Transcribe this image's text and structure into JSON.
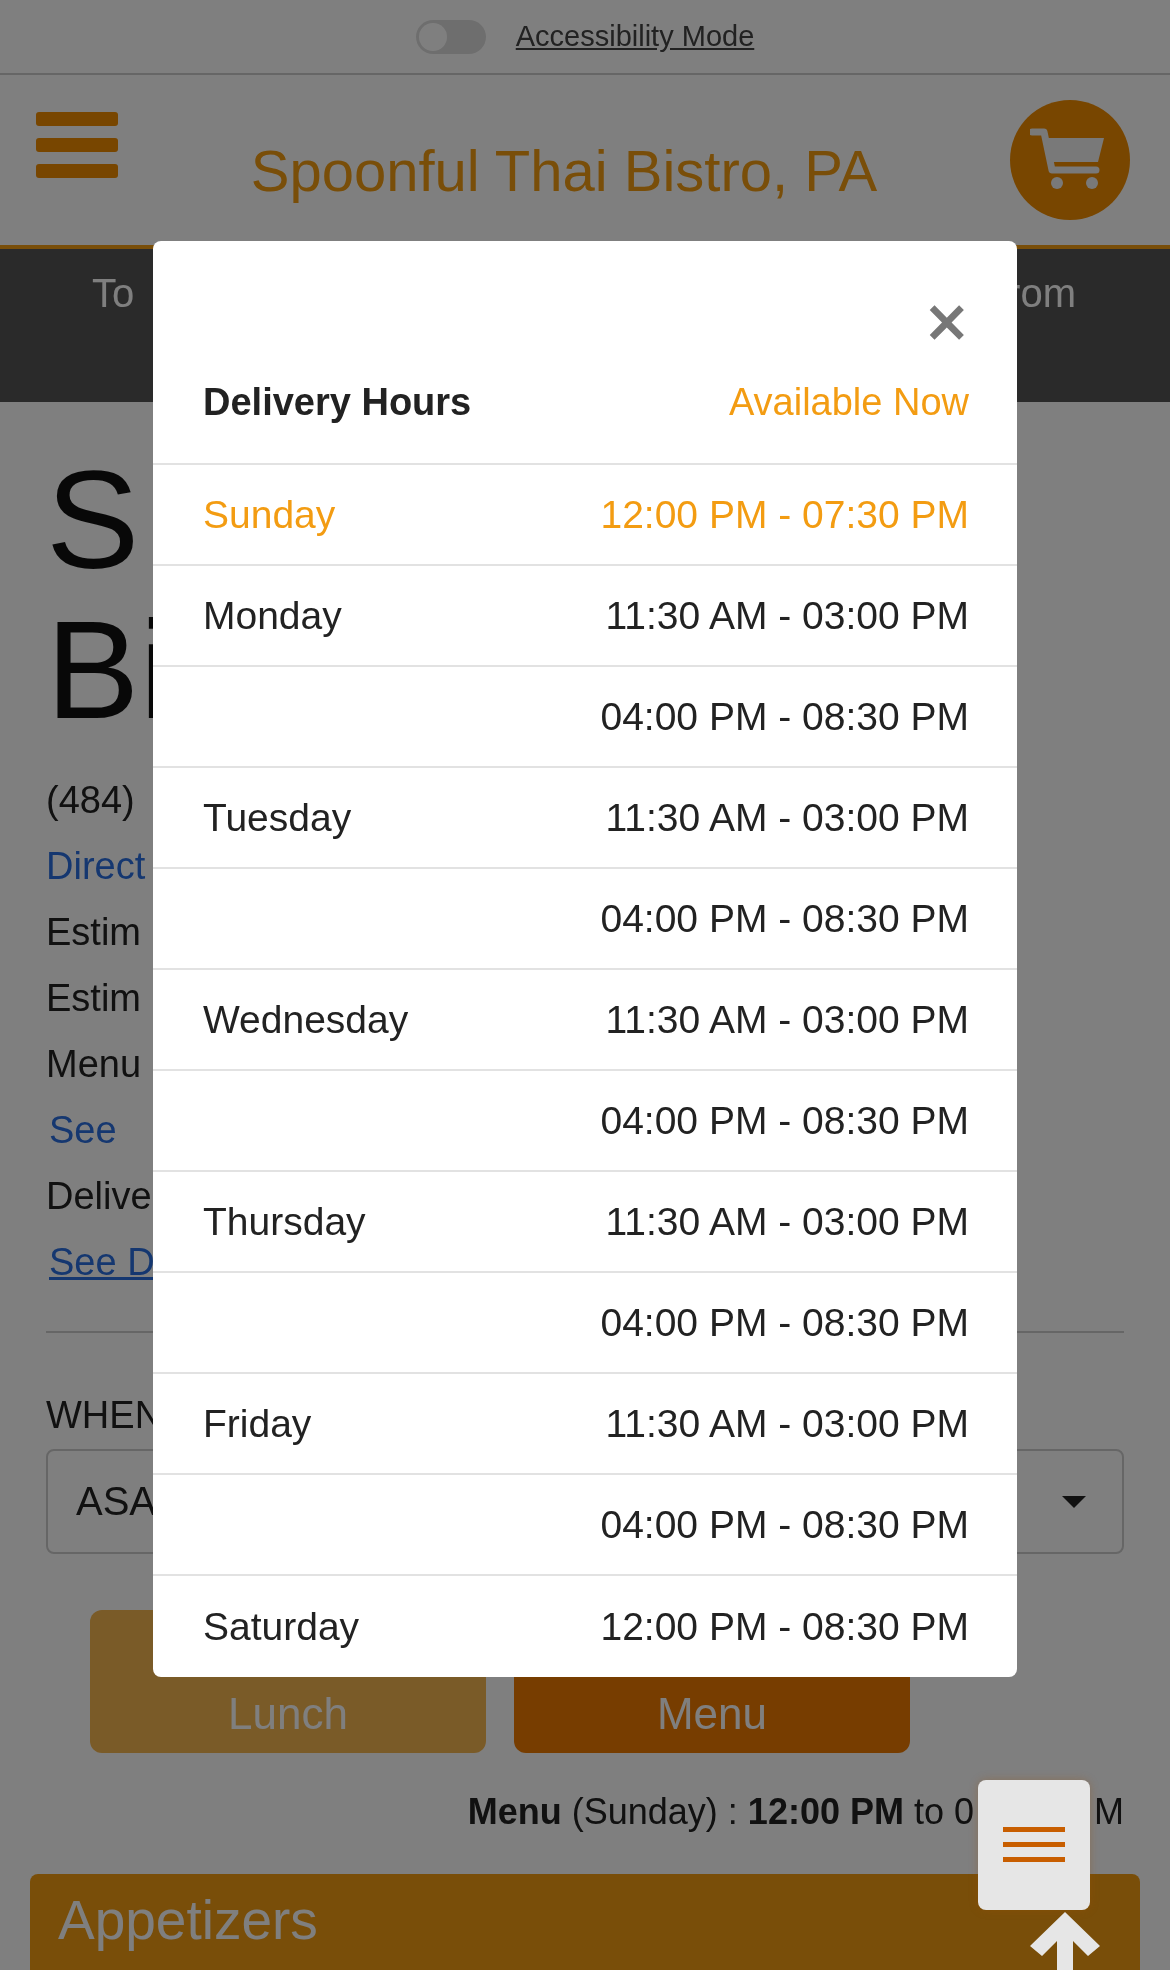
{
  "accessibility": {
    "label": "Accessibility Mode",
    "on": false
  },
  "header": {
    "title": "Spoonful Thai Bistro, PA"
  },
  "banner": {
    "left": "To",
    "right": "rom"
  },
  "page": {
    "name_lines": [
      "S",
      "Bi"
    ],
    "phone": "(484)",
    "directions": "Direct",
    "estimate_1": "Estim",
    "estimate_2": "Estim",
    "menu_label": "Menu",
    "see_menu": "See",
    "delivery_label": "Delive",
    "see_delivery": "See D",
    "when_label": "WHEN",
    "when_value": "ASA",
    "buttons": [
      {
        "label": "Lunch",
        "selected": false
      },
      {
        "label": "Menu",
        "selected": true
      }
    ],
    "menu_hours": "**Menu** (Sunday) : **12:00 PM** to 0",
    "menu_hours_end": "M",
    "section": "Appetizers"
  },
  "modal": {
    "title": "Delivery Hours",
    "status": "Available Now",
    "close": "×",
    "days": [
      {
        "day": "Sunday",
        "today": true,
        "hours": [
          "12:00 PM - 07:30 PM"
        ]
      },
      {
        "day": "Monday",
        "today": false,
        "hours": [
          "11:30 AM - 03:00 PM",
          "04:00 PM - 08:30 PM"
        ]
      },
      {
        "day": "Tuesday",
        "today": false,
        "hours": [
          "11:30 AM - 03:00 PM",
          "04:00 PM - 08:30 PM"
        ]
      },
      {
        "day": "Wednesday",
        "today": false,
        "hours": [
          "11:30 AM - 03:00 PM",
          "04:00 PM - 08:30 PM"
        ]
      },
      {
        "day": "Thursday",
        "today": false,
        "hours": [
          "11:30 AM - 03:00 PM",
          "04:00 PM - 08:30 PM"
        ]
      },
      {
        "day": "Friday",
        "today": false,
        "hours": [
          "11:30 AM - 03:00 PM",
          "04:00 PM - 08:30 PM"
        ]
      },
      {
        "day": "Saturday",
        "today": false,
        "hours": [
          "12:00 PM - 08:30 PM"
        ]
      }
    ]
  }
}
